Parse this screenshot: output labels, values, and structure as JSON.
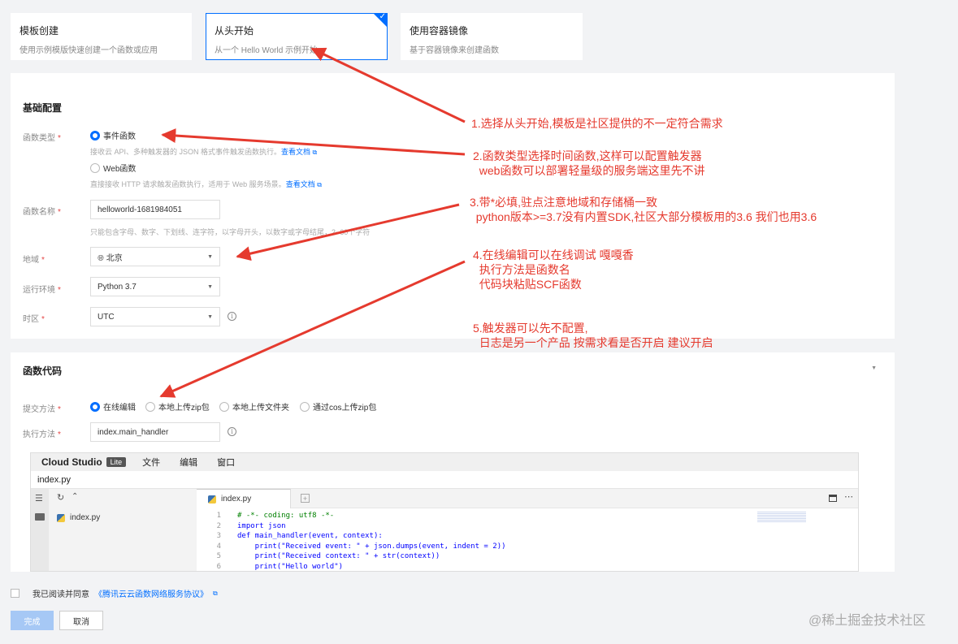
{
  "templates": [
    {
      "title": "模板创建",
      "desc": "使用示例模版快速创建一个函数或应用"
    },
    {
      "title": "从头开始",
      "desc": "从一个 Hello World 示例开始"
    },
    {
      "title": "使用容器镜像",
      "desc": "基于容器镜像来创建函数"
    }
  ],
  "basic": {
    "title": "基础配置",
    "func_type_label": "函数类型",
    "event_label": "事件函数",
    "event_hint": "接收云 API、多种触发器的 JSON 格式事件触发函数执行。",
    "event_link": "查看文档",
    "web_label": "Web函数",
    "web_hint": "直接接收 HTTP 请求触发函数执行，适用于 Web 服务场景。",
    "web_link": "查看文档",
    "name_label": "函数名称",
    "name_value": "helloworld-1681984051",
    "name_hint": "只能包含字母、数字、下划线、连字符，以字母开头，以数字或字母结尾，2~60个字符",
    "region_label": "地域",
    "region_value": "北京",
    "runtime_label": "运行环境",
    "runtime_value": "Python 3.7",
    "tz_label": "时区",
    "tz_value": "UTC",
    "required_mark": "*"
  },
  "code": {
    "title": "函数代码",
    "submit_label": "提交方法",
    "submit_options": [
      "在线编辑",
      "本地上传zip包",
      "本地上传文件夹",
      "通过cos上传zip包"
    ],
    "handler_label": "执行方法",
    "handler_value": "index.main_handler"
  },
  "ide": {
    "brand": "Cloud Studio",
    "lite": "Lite",
    "menus": [
      "文件",
      "编辑",
      "窗口"
    ],
    "current_file": "index.py",
    "tree_file": "index.py",
    "tab_file": "index.py",
    "lines": [
      {
        "n": "1",
        "t": "# -*- coding: utf8 -*-"
      },
      {
        "n": "2",
        "t": "import json"
      },
      {
        "n": "3",
        "t": "def main_handler(event, context):"
      },
      {
        "n": "4",
        "t": "    print(\"Received event: \" + json.dumps(event, indent = 2))"
      },
      {
        "n": "5",
        "t": "    print(\"Received context: \" + str(context))"
      },
      {
        "n": "6",
        "t": "    print(\"Hello world\")"
      }
    ]
  },
  "footer": {
    "agree_text": "我已阅读并同意",
    "agree_link": "《腾讯云云函数网络服务协议》",
    "confirm": "完成",
    "cancel": "取消"
  },
  "notes": {
    "n1": "1.选择从头开始,模板是社区提供的不一定符合需求",
    "n2": "2.函数类型选择时间函数,这样可以配置触发器\n  web函数可以部署轻量级的服务端这里先不讲",
    "n3": "3.带*必填,驻点注意地域和存储桶一致\n  python版本>=3.7没有内置SDK,社区大部分模板用的3.6 我们也用3.6",
    "n4": "4.在线编辑可以在线调试 嘎嘎香\n  执行方法是函数名\n  代码块粘贴SCF函数",
    "n5": "5.触发器可以先不配置,\n  日志是另一个产品 按需求看是否开启 建议开启"
  },
  "watermark": "@稀土掘金技术社区",
  "colors": {
    "accent": "#006eff",
    "annotation": "#e53a2e"
  }
}
